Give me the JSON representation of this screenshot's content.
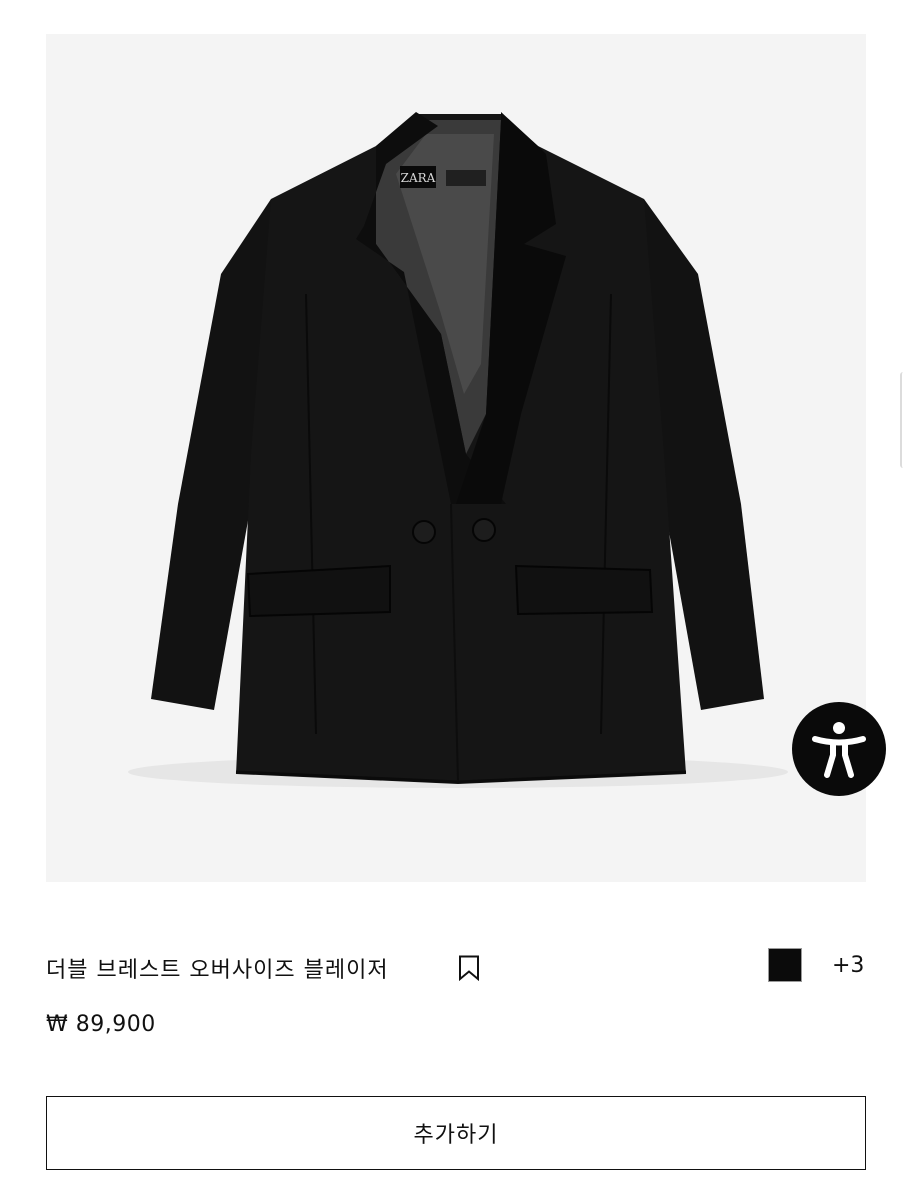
{
  "product": {
    "image_alt": "검은색 더블 브레스트 블레이저",
    "brand_label": "ZARA",
    "title": "더블 브레스트 오버사이즈 블레이저",
    "price": "₩ 89,900",
    "extra_colors": "+3",
    "swatch_color": "#0b0b0b"
  },
  "actions": {
    "add_label": "추가하기"
  },
  "icons": {
    "bookmark": "bookmark-icon",
    "accessibility": "accessibility-icon"
  }
}
